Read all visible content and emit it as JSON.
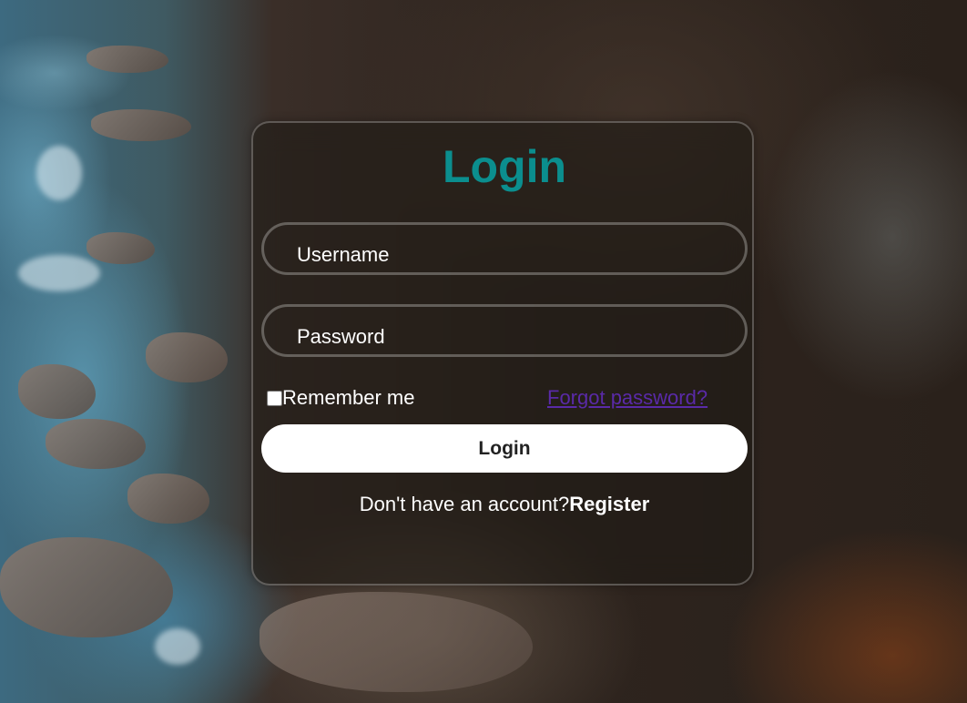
{
  "login": {
    "title": "Login",
    "username_placeholder": "Username",
    "password_placeholder": "Password",
    "remember_label": "Remember me",
    "forgot_label": "Forgot password?",
    "submit_label": "Login",
    "register_prompt": "Don't have an account?",
    "register_link": "Register"
  },
  "colors": {
    "title": "#0b8e8e",
    "link": "#5a2aa8",
    "button_bg": "#ffffff"
  }
}
